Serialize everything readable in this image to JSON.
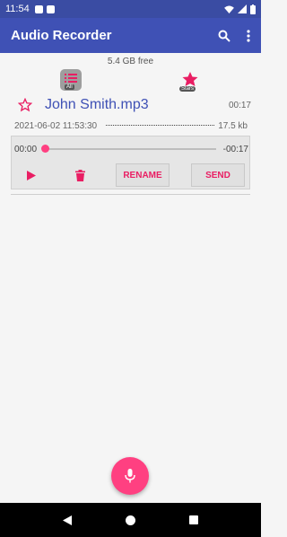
{
  "status_bar": {
    "time": "11:54"
  },
  "app_bar": {
    "title": "Audio Recorder",
    "search_icon": "search-icon",
    "overflow_icon": "more-vert-icon"
  },
  "storage": {
    "free_text": "5.4 GB free"
  },
  "filters": {
    "all_label": "All",
    "stars_label": "Stars"
  },
  "recording": {
    "name": "John Smith.mp3",
    "duration": "00:17",
    "date": "2021-06-02 11:53:30",
    "size": "17.5 kb",
    "starred": false
  },
  "player": {
    "current_time": "00:00",
    "remaining_time": "-00:17",
    "progress": 0,
    "rename_label": "RENAME",
    "send_label": "SEND"
  },
  "colors": {
    "primary": "#3f51b5",
    "primary_dark": "#3a4ca3",
    "accent": "#ff4081"
  }
}
